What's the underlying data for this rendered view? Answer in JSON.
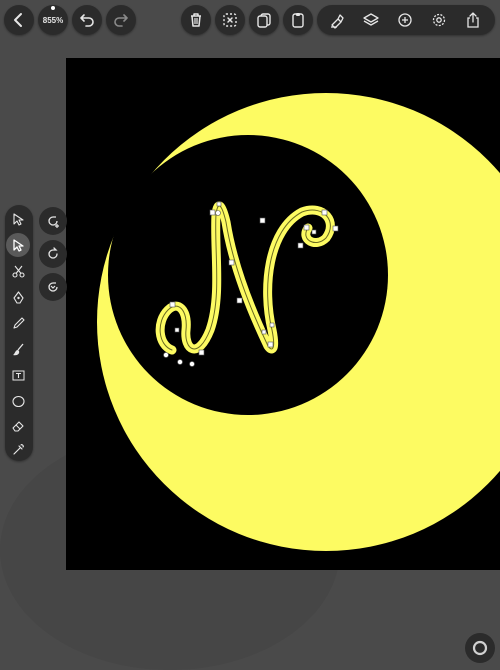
{
  "toolbar": {
    "zoom_label": "855%",
    "back": "chevron-left-icon",
    "undo": "undo-icon",
    "redo": "redo-icon",
    "actions": [
      "trash-icon",
      "deselect-icon",
      "duplicate-icon",
      "paste-icon"
    ],
    "right_group": [
      "style-icon",
      "layers-icon",
      "add-icon",
      "settings-icon",
      "share-icon"
    ]
  },
  "tools": [
    "select-arrow-icon",
    "direct-select-icon",
    "scissors-icon",
    "pen-icon",
    "pencil-icon",
    "brush-icon",
    "text-icon",
    "ellipse-icon",
    "eraser-icon",
    "eyedropper-icon"
  ],
  "active_tool": "direct-select-icon",
  "rotation_buttons": [
    "rotate-add-icon",
    "rotate-cw-icon",
    "rotate-reset-icon"
  ],
  "colors": {
    "accent_fill": "#fdfb62",
    "canvas_bg": "#000000",
    "ui_bg": "#4a4a4a",
    "button_bg": "#2b2b2b"
  }
}
